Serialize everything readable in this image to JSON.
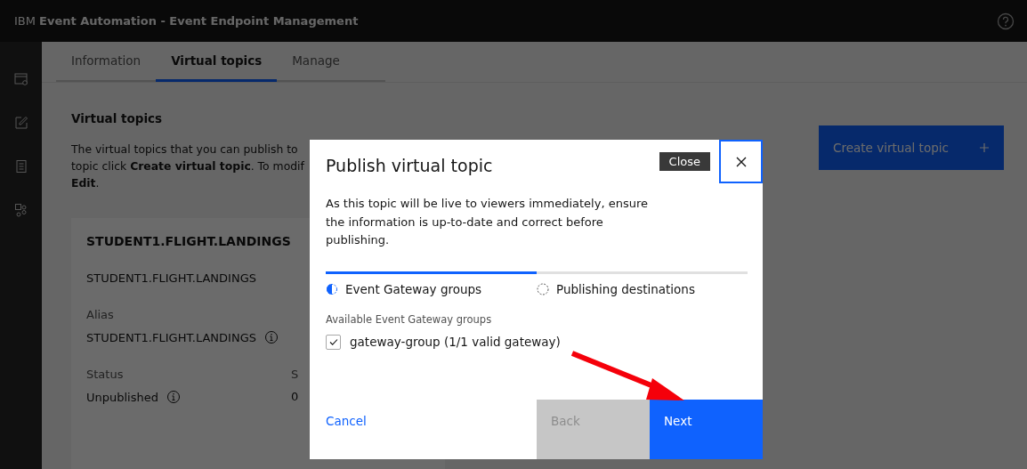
{
  "header": {
    "brand": "IBM",
    "title": "Event Automation - Event Endpoint Management"
  },
  "tabs": [
    {
      "label": "Information",
      "selected": false
    },
    {
      "label": "Virtual topics",
      "selected": true
    },
    {
      "label": "Manage",
      "selected": false
    }
  ],
  "page": {
    "section_title": "Virtual topics",
    "description_lines": [
      "The virtual topics that you can publish to",
      "topic click **Create virtual topic**. To modif",
      "**Edit**."
    ],
    "create_button": "Create virtual topic",
    "card": {
      "title": "STUDENT1.FLIGHT.LANDINGS",
      "topic_name": "STUDENT1.FLIGHT.LANDINGS",
      "fields": [
        {
          "label": "Alias",
          "value": "STUDENT1.FLIGHT.LANDINGS",
          "info": true
        },
        {
          "label": "Status",
          "value": "Unpublished",
          "info": true
        }
      ],
      "column_2": {
        "label": "S",
        "value": "0"
      }
    }
  },
  "dialog": {
    "title": "Publish virtual topic",
    "close_tooltip": "Close",
    "message": "As this topic will be live to viewers immediately, ensure the information is up-to-date and correct before publishing.",
    "steps": [
      {
        "label": "Event Gateway groups",
        "selected": true
      },
      {
        "label": "Publishing destinations",
        "selected": false
      }
    ],
    "section_label": "Available Event Gateway groups",
    "options": [
      {
        "label": "gateway-group (1/1 valid gateway)",
        "checked": true
      }
    ],
    "cancel": "Cancel",
    "back": {
      "label": "Back",
      "disabled": true
    },
    "next": {
      "label": "Next",
      "disabled": false
    }
  }
}
